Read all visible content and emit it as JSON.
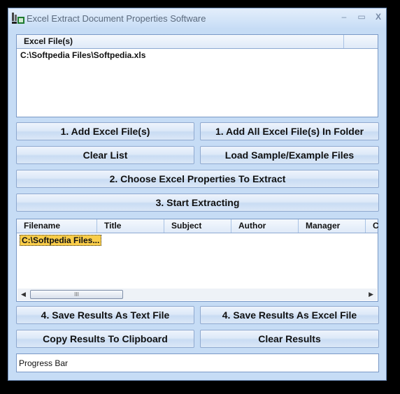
{
  "window": {
    "title": "Excel Extract Document Properties Software",
    "controls": {
      "minimize": "–",
      "maximize": "▭",
      "close": "X"
    }
  },
  "file_list": {
    "header": "Excel File(s)",
    "items": [
      "C:\\Softpedia Files\\Softpedia.xls"
    ]
  },
  "buttons": {
    "add_files": "1. Add Excel File(s)",
    "add_folder": "1. Add All Excel File(s) In Folder",
    "clear_list": "Clear List",
    "load_sample": "Load Sample/Example Files",
    "choose_props": "2. Choose Excel Properties To Extract",
    "start": "3. Start Extracting",
    "save_text": "4. Save Results As Text File",
    "save_excel": "4. Save Results As Excel File",
    "copy_clipboard": "Copy Results To Clipboard",
    "clear_results": "Clear Results"
  },
  "results": {
    "columns": [
      "Filename",
      "Title",
      "Subject",
      "Author",
      "Manager",
      "C"
    ],
    "rows": [
      [
        "C:\\Softpedia Files..."
      ]
    ],
    "scroll": {
      "left": "◀",
      "right": "▶",
      "grip": "III"
    }
  },
  "progress": {
    "label": "Progress Bar"
  }
}
